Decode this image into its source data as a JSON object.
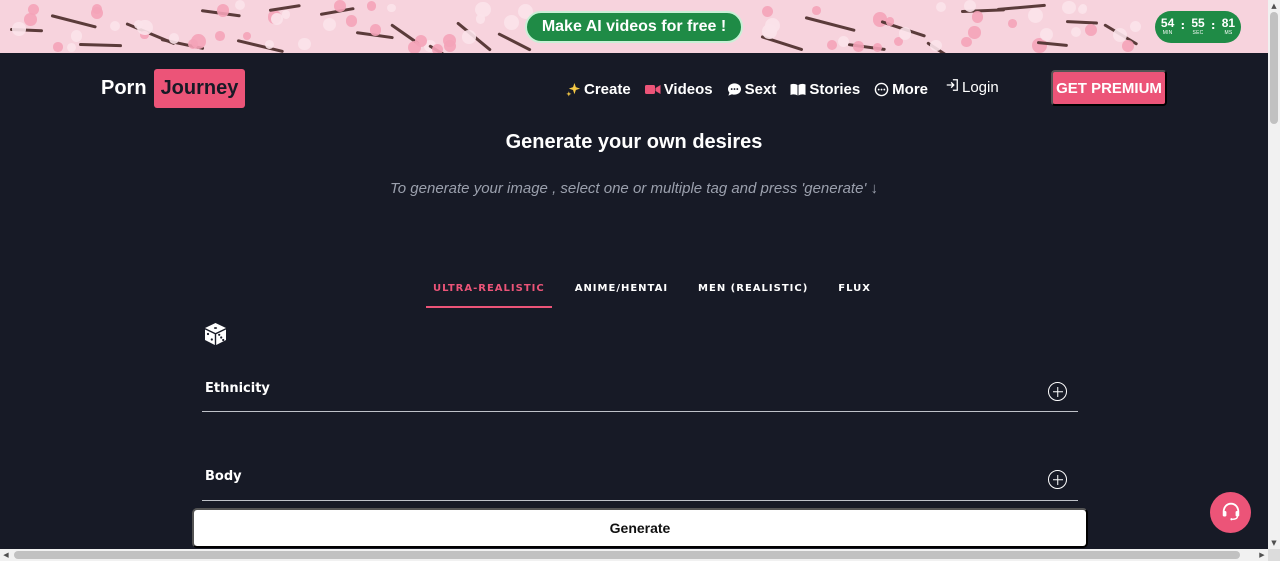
{
  "banner": {
    "cta_label": "Make AI videos for free !",
    "timer": [
      {
        "value": "54",
        "unit": "MIN"
      },
      {
        "value": "55",
        "unit": "SEC"
      },
      {
        "value": "81",
        "unit": "MS"
      }
    ]
  },
  "header": {
    "logo_word1": "Porn",
    "logo_word2": "Journey",
    "nav": [
      {
        "label": "Create",
        "icon": "sparkles-icon"
      },
      {
        "label": "Videos",
        "icon": "video-camera-icon"
      },
      {
        "label": "Sext",
        "icon": "chat-bubble-icon"
      },
      {
        "label": "Stories",
        "icon": "book-icon"
      },
      {
        "label": "More",
        "icon": "more-circle-icon"
      }
    ],
    "login_label": "Login",
    "premium_label": "GET PREMIUM"
  },
  "main": {
    "title": "Generate your own desires",
    "subtitle": "To generate your image , select one or multiple tag and press 'generate' ↓",
    "tabs": [
      {
        "label": "ULTRA-REALISTIC",
        "active": true
      },
      {
        "label": "ANIME/HENTAI",
        "active": false
      },
      {
        "label": "MEN (REALISTIC)",
        "active": false
      },
      {
        "label": "FLUX",
        "active": false
      }
    ],
    "sections": [
      {
        "label": "Ethnicity"
      },
      {
        "label": "Body"
      }
    ],
    "generate_label": "Generate"
  },
  "colors": {
    "accent": "#ec5478",
    "background": "#171a26",
    "banner_green": "#1f8b46",
    "banner_pink": "#f7d3dd"
  }
}
